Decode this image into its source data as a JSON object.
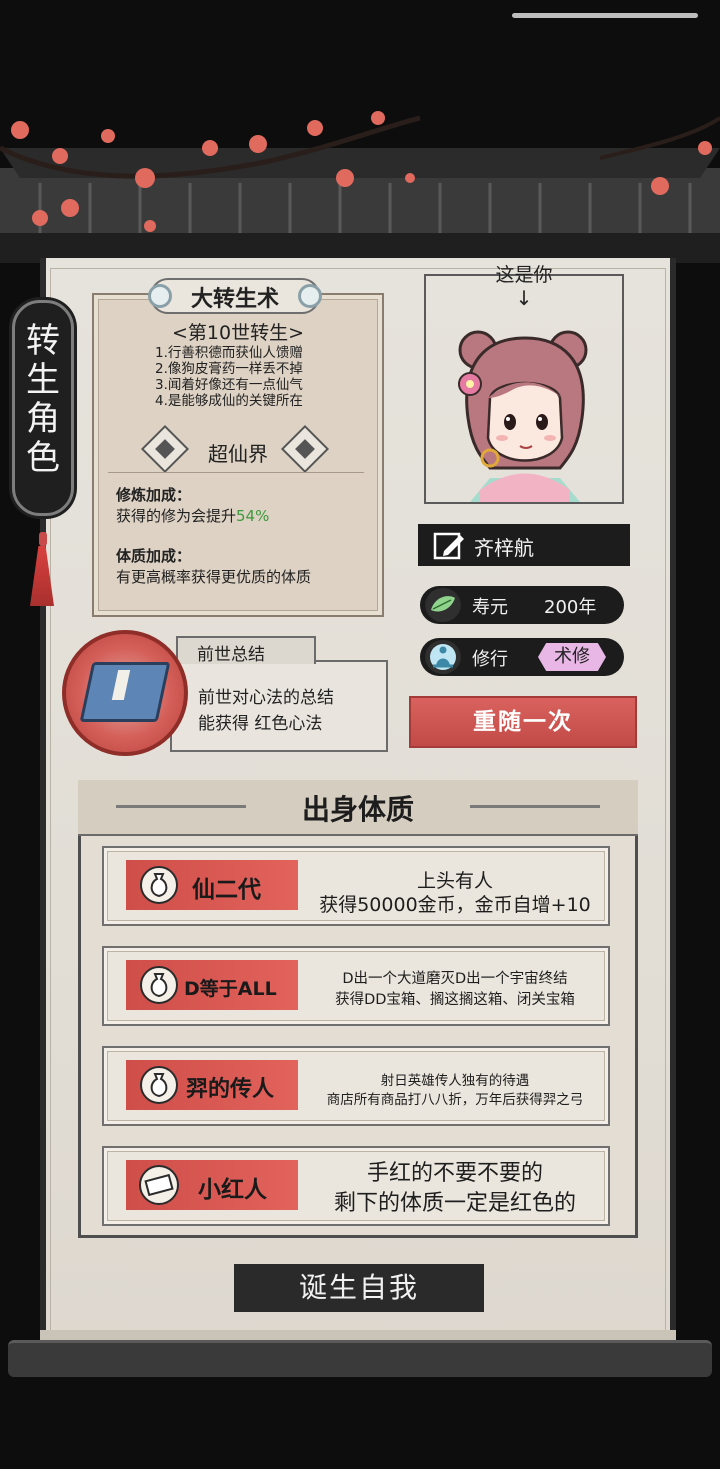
{
  "side_title": "转生角色",
  "technique": {
    "title": "大转生术",
    "subtitle": "<第10世转生>",
    "lines": [
      "1.行善积德而获仙人馈赠",
      "2.像狗皮膏药一样丢不掉",
      "3.闻着好像还有一点仙气",
      "4.是能够成仙的关键所在"
    ],
    "realm": "超仙界",
    "cultivation_title": "修炼加成：",
    "cultivation_desc_prefix": "获得的修为会提升",
    "cultivation_value": "54%",
    "constitution_title": "体质加成：",
    "constitution_desc": "有更高概率获得更优质的体质"
  },
  "past_life": {
    "title": "前世总结",
    "line1": "前世对心法的总结",
    "line2": "能获得 红色心法"
  },
  "character": {
    "caption": "这是你",
    "arrow": "↓",
    "name": "齐梓航",
    "lifespan_label": "寿元",
    "lifespan_value": "200年",
    "path_label": "修行",
    "path_value": "术修"
  },
  "reroll_label": "重随一次",
  "birth": {
    "title": "出身体质",
    "traits": [
      {
        "name": "仙二代",
        "icon": "money-bag-icon",
        "desc1": "上头有人",
        "desc2": "获得50000金币，金币自增+10"
      },
      {
        "name": "D等于ALL",
        "icon": "money-bag-icon",
        "desc1": "D出一个大道磨灭D出一个宇宙终结",
        "desc2": "获得DD宝箱、搁这搁这箱、闭关宝箱"
      },
      {
        "name": "羿的传人",
        "icon": "money-bag-icon",
        "desc1": "射日英雄传人独有的待遇",
        "desc2": "商店所有商品打八八折，万年后获得羿之弓"
      },
      {
        "name": "小红人",
        "icon": "scroll-icon",
        "desc1": "手红的不要不要的",
        "desc2": "剩下的体质一定是红色的"
      }
    ]
  },
  "born_label": "诞生自我",
  "colors": {
    "accent_red": "#cf4e49",
    "green_value": "#3c9a3c",
    "path_badge": "#e9b7e6"
  }
}
